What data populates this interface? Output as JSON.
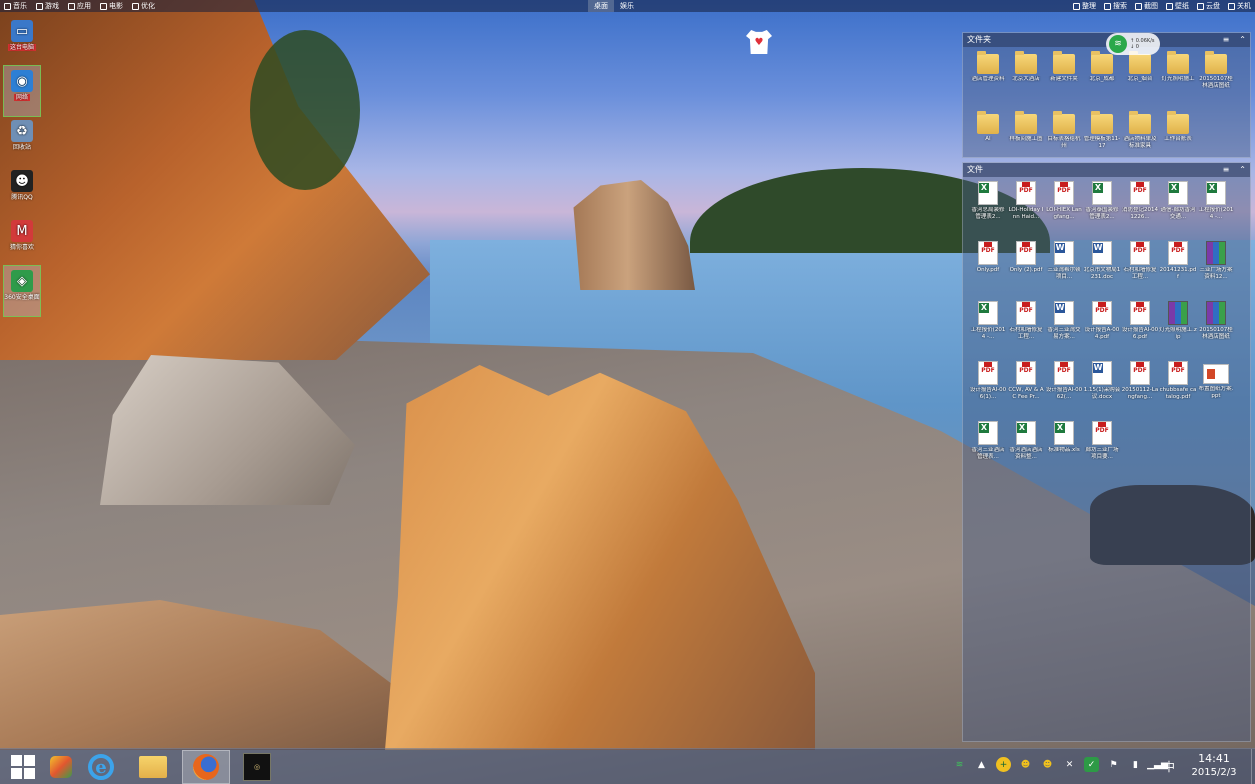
{
  "topbar": {
    "left": [
      {
        "label": "音乐",
        "icon": "music-icon"
      },
      {
        "label": "游戏",
        "icon": "gamepad-icon"
      },
      {
        "label": "应用",
        "icon": "apps-icon"
      },
      {
        "label": "电影",
        "icon": "film-icon"
      },
      {
        "label": "优化",
        "icon": "tune-icon"
      }
    ],
    "center_tabs": [
      {
        "label": "桌面",
        "active": true
      },
      {
        "label": "娱乐",
        "active": false
      }
    ],
    "right": [
      {
        "label": "整理",
        "icon": "organize-icon"
      },
      {
        "label": "搜索",
        "icon": "search-icon"
      },
      {
        "label": "截图",
        "icon": "screenshot-icon"
      },
      {
        "label": "壁纸",
        "icon": "wallpaper-icon"
      },
      {
        "label": "云盘",
        "icon": "cloud-icon"
      },
      {
        "label": "关机",
        "icon": "power-icon"
      }
    ]
  },
  "desktop_icons": [
    {
      "label": "这台电脑",
      "icon": "computer-icon",
      "color": "#3a78c9",
      "highlight": true
    },
    {
      "label": "网络",
      "icon": "network-icon",
      "color": "#2d7fd4",
      "highlight": true,
      "selected": true
    },
    {
      "label": "回收站",
      "icon": "recycle-bin-icon",
      "color": "#6f8fb5"
    },
    {
      "label": "腾讯QQ",
      "icon": "qq-icon",
      "color": "#222"
    },
    {
      "label": "猜你喜欢",
      "icon": "heart-icon",
      "color": "#d23a3a"
    },
    {
      "label": "360安全桌面",
      "icon": "shield-icon",
      "color": "#2f9b4a",
      "selected": true
    }
  ],
  "fence_folders": {
    "title": "文件夹",
    "items": [
      {
        "label": "酒店管理资料"
      },
      {
        "label": "北京大酒店"
      },
      {
        "label": "新建文件夹"
      },
      {
        "label": "北京_成都"
      },
      {
        "label": "北京_烟台"
      },
      {
        "label": "灯光照明施工"
      },
      {
        "label": "20150107桂林酒店图纸"
      },
      {
        "label": "AI"
      },
      {
        "label": "样板间施工图"
      },
      {
        "label": "目标表格给杭州"
      },
      {
        "label": "管理模板第11-17"
      },
      {
        "label": "酒店物料单及标准家具"
      },
      {
        "label": "工作台账表"
      }
    ]
  },
  "fence_files": {
    "title": "文件",
    "items": [
      {
        "label": "香河总局装修管理表2...",
        "type": "xls"
      },
      {
        "label": "LOI-Holiday Inn Haid...",
        "type": "pdf"
      },
      {
        "label": "LOI-HIEX Langfang...",
        "type": "pdf"
      },
      {
        "label": "香河泰国装修管理表2...",
        "type": "xls"
      },
      {
        "label": "消防登记20141226...",
        "type": "pdf"
      },
      {
        "label": "通信-廊坊香河交通...",
        "type": "xls"
      },
      {
        "label": "工程报价(2014 -...",
        "type": "xls"
      },
      {
        "label": "Only.pdf",
        "type": "pdf"
      },
      {
        "label": "Only (2).pdf",
        "type": "pdf"
      },
      {
        "label": "三亚湾希尔顿项目...",
        "type": "doc"
      },
      {
        "label": "北京市文物局1231.doc",
        "type": "doc"
      },
      {
        "label": "石村和墙修复工程...",
        "type": "pdf"
      },
      {
        "label": "20141231.pdf",
        "type": "pdf"
      },
      {
        "label": "三亚广场方案资料12...",
        "type": "rar"
      },
      {
        "label": "工程报价(2014 -...",
        "type": "xls"
      },
      {
        "label": "石村和墙修复工程...",
        "type": "pdf"
      },
      {
        "label": "香河三亚湾交易方案...",
        "type": "doc"
      },
      {
        "label": "设计报告A-004.pdf",
        "type": "pdf"
      },
      {
        "label": "设计报告AI-006.pdf",
        "type": "pdf"
      },
      {
        "label": "灯光照明施工.zip",
        "type": "rar"
      },
      {
        "label": "20150107桂林酒店图纸",
        "type": "rar"
      },
      {
        "label": "设计报告AI-006(1)...",
        "type": "pdf"
      },
      {
        "label": "CCW, AV & AC Fee Pr...",
        "type": "pdf"
      },
      {
        "label": "设计报告AI-0062(...",
        "type": "pdf"
      },
      {
        "label": "1.15(1)采购会议.docx",
        "type": "doc"
      },
      {
        "label": "20150112-Langfang...",
        "type": "pdf"
      },
      {
        "label": "chubbsafe catalog.pdf",
        "type": "pdf"
      },
      {
        "label": "布置图纸方案.ppt",
        "type": "ppt"
      },
      {
        "label": "香河三亚酒店管理表...",
        "type": "xls"
      },
      {
        "label": "香河酒店酒店资料整...",
        "type": "xls"
      },
      {
        "label": "标准物品.xls",
        "type": "xls"
      },
      {
        "label": "廊坊三亚广场项目要...",
        "type": "pdf"
      }
    ]
  },
  "network_widget": {
    "up": "0.06K/s",
    "down": "0"
  },
  "taskbar": {
    "apps": [
      {
        "name": "start-button",
        "active": false
      },
      {
        "name": "360-security",
        "active": false
      },
      {
        "name": "internet-explorer",
        "active": false
      },
      {
        "name": "file-explorer",
        "active": false
      },
      {
        "name": "firefox",
        "active": true
      },
      {
        "name": "game-app",
        "active": false
      }
    ],
    "ime": "中",
    "time": "14:41",
    "date": "2015/2/3"
  }
}
